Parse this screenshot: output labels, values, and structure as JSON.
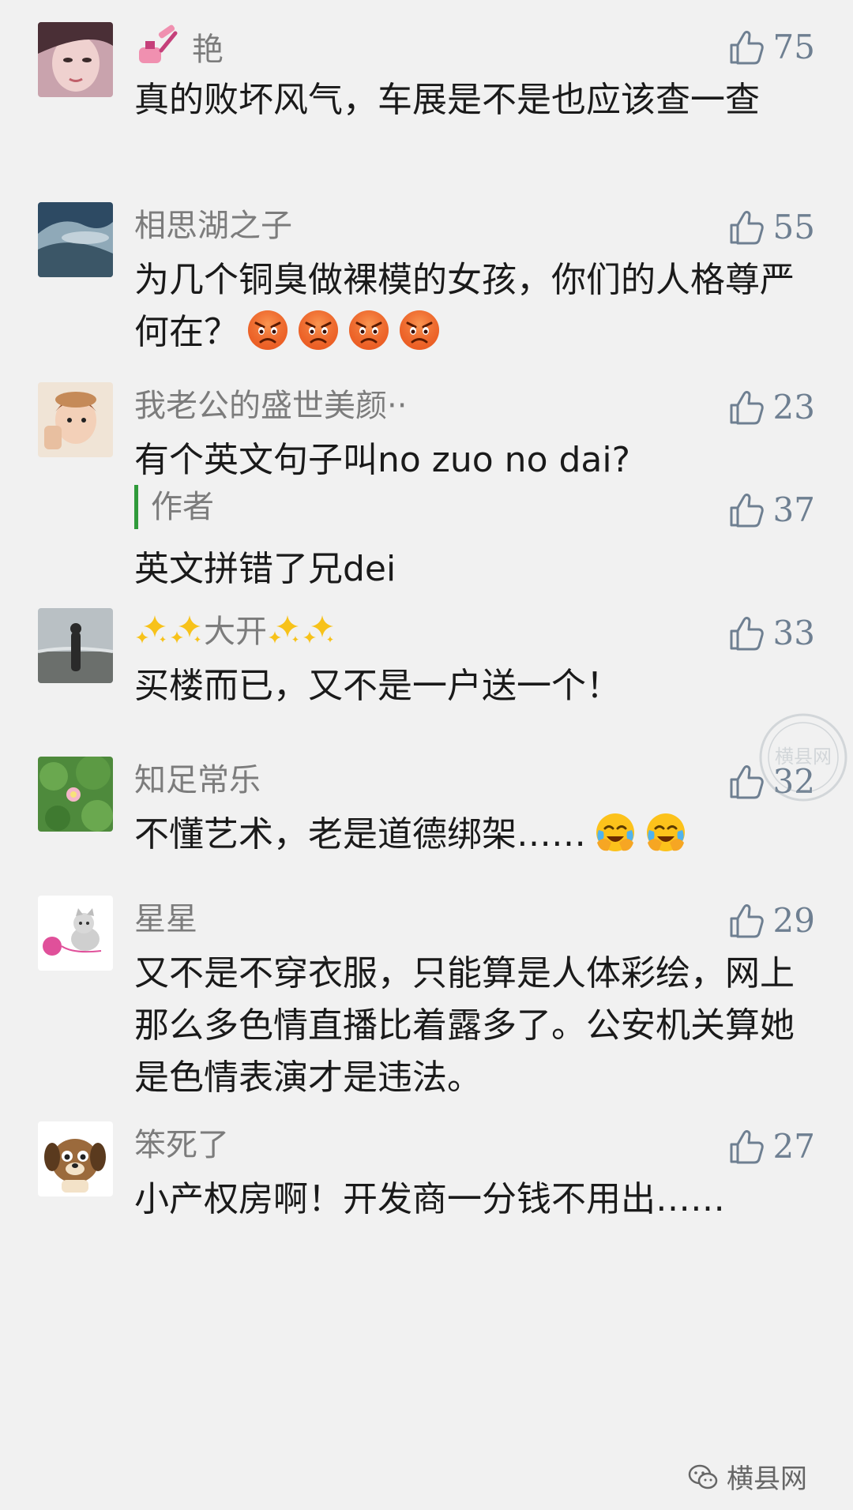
{
  "comments": [
    {
      "name": "艳",
      "likes": "75",
      "text": "真的败坏风气，车展是不是也应该查一查"
    },
    {
      "name": "相思湖之子",
      "likes": "55",
      "text": "为几个铜臭做裸模的女孩，你们的人格尊严何在？"
    },
    {
      "name": "我老公的盛世美颜··",
      "likes": "23",
      "text": "有个英文句子叫no zuo no dai?",
      "reply": {
        "author": "作者",
        "likes": "37",
        "text": "英文拼错了兄dei"
      }
    },
    {
      "name": "大开",
      "likes": "33",
      "text": "买楼而已，又不是一户送一个！"
    },
    {
      "name": "知足常乐",
      "likes": "32",
      "text": "不懂艺术，老是道德绑架……"
    },
    {
      "name": "星星",
      "likes": "29",
      "text": "又不是不穿衣服，只能算是人体彩绘，网上那么多色情直播比着露多了。公安机关算她是色情表演才是违法。"
    },
    {
      "name": "笨死了",
      "likes": "27",
      "text": "小产权房啊！开发商一分钱不用出……"
    }
  ],
  "icons": {
    "like": "thumbs-up-outline-icon",
    "angry_emoji": "angry-face-icon",
    "crying_emoji": "crying-laughing-face-icon",
    "sparkles": "sparkles-icon",
    "wechat": "wechat-logo-icon"
  },
  "watermark": {
    "text": "横县网",
    "stamp_text": "横县网"
  },
  "colors": {
    "background": "#f1f1f1",
    "name": "#7c7c7c",
    "likes": "#6e7f91",
    "reply_bar": "#2f9a3a"
  }
}
